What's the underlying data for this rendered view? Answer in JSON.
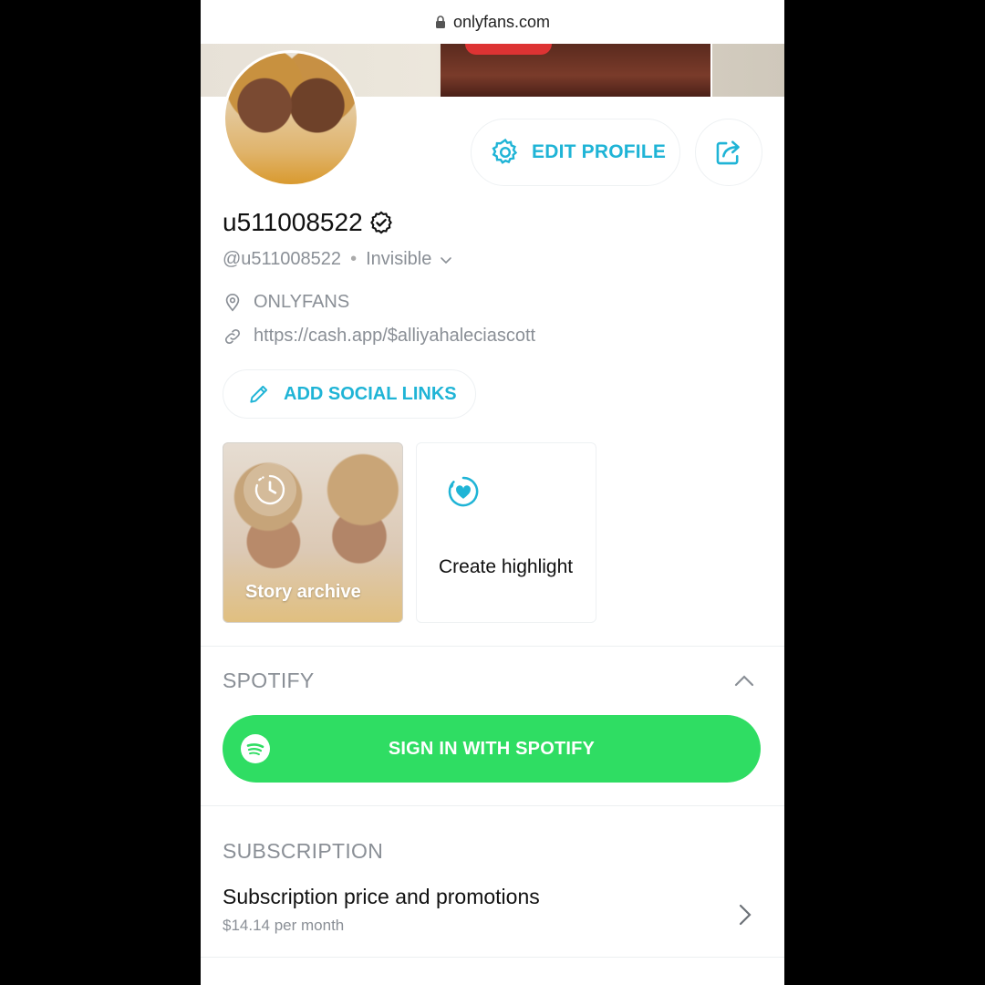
{
  "browser": {
    "url": "onlyfans.com"
  },
  "profile": {
    "display_name": "u511008522",
    "handle": "@u511008522",
    "status": "Invisible",
    "location": "ONLYFANS",
    "website": "https://cash.app/$alliyahaleciascott",
    "edit_label": "EDIT PROFILE",
    "add_social_label": "ADD SOCIAL LINKS"
  },
  "highlights": {
    "archive_label": "Story archive",
    "create_label": "Create highlight"
  },
  "spotify": {
    "section_title": "SPOTIFY",
    "signin_label": "SIGN IN WITH SPOTIFY"
  },
  "subscription": {
    "section_title": "SUBSCRIPTION",
    "row_title": "Subscription price and promotions",
    "price": "$14.14 per month"
  },
  "colors": {
    "accent": "#1fb4d6",
    "spotify_green": "#2fdd63",
    "muted_text": "#8a8f96"
  }
}
